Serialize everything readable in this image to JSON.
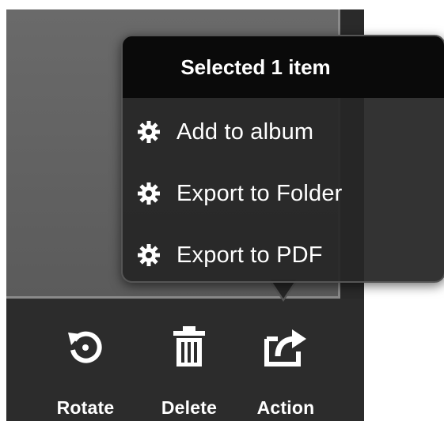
{
  "popover": {
    "title": "Selected 1 item",
    "items": [
      {
        "label": "Add to album",
        "icon": "gear-icon"
      },
      {
        "label": "Export to Folder",
        "icon": "gear-icon"
      },
      {
        "label": "Export to PDF",
        "icon": "gear-icon"
      }
    ]
  },
  "toolbar": {
    "rotate_label": "Rotate",
    "delete_label": "Delete",
    "action_label": "Action",
    "rotate_icon": "rotate-icon",
    "delete_icon": "trash-icon",
    "action_icon": "share-icon"
  },
  "colors": {
    "toolbar_bg": "#2c2c2c",
    "popover_header_bg": "#0a0a0a",
    "photo_panel": "#636363",
    "text": "#ffffff"
  }
}
